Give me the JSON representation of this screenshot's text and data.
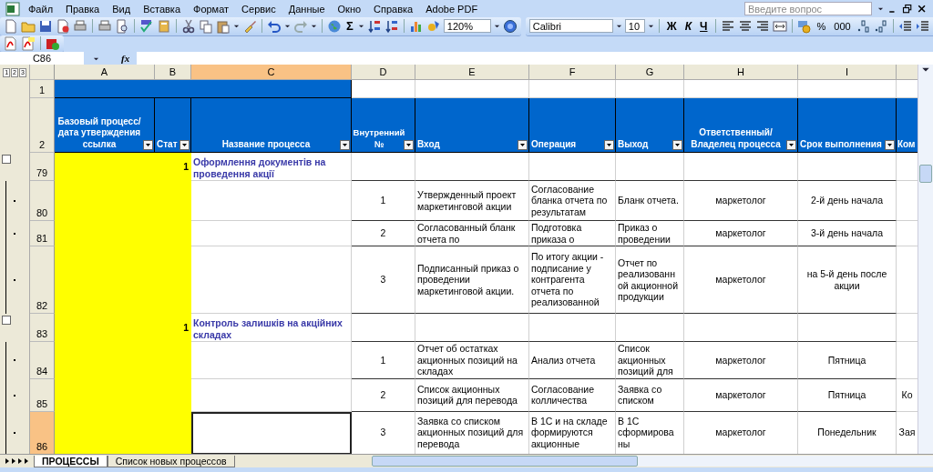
{
  "menu": [
    "Файл",
    "Правка",
    "Вид",
    "Вставка",
    "Формат",
    "Сервис",
    "Данные",
    "Окно",
    "Справка",
    "Adobe PDF"
  ],
  "help_search": {
    "placeholder": "Введите вопрос"
  },
  "toolbar": {
    "autosum": "Σ",
    "zoom": "120%",
    "font": "Calibri",
    "font_size": "10",
    "bold": "Ж",
    "italic": "К",
    "underline": "Ч",
    "percent": "%",
    "thousands": "000"
  },
  "formula_bar": {
    "name_box": "C86",
    "function_label": "fx"
  },
  "outline_levels": [
    "1",
    "2",
    "3"
  ],
  "columns": [
    {
      "letter": "A",
      "selected": false
    },
    {
      "letter": "B",
      "selected": false
    },
    {
      "letter": "C",
      "selected": true
    },
    {
      "letter": "D",
      "selected": false
    },
    {
      "letter": "E",
      "selected": false
    },
    {
      "letter": "F",
      "selected": false
    },
    {
      "letter": "G",
      "selected": false
    },
    {
      "letter": "H",
      "selected": false
    },
    {
      "letter": "I",
      "selected": false
    }
  ],
  "header_rows": [
    "1",
    "2"
  ],
  "headers": [
    {
      "text": "Базовый процесс/ дата утверждения ссылка",
      "filter": true
    },
    {
      "text": "Стат",
      "filter": true
    },
    {
      "text": "Название процесса",
      "filter": true
    },
    {
      "text": "Внутренний №",
      "filter": true
    },
    {
      "text": "Вход",
      "filter": true
    },
    {
      "text": "Операция",
      "filter": true
    },
    {
      "text": "Выход",
      "filter": true
    },
    {
      "text": "Ответственный/Владелец процесса",
      "filter": true
    },
    {
      "text": "Срок выполнения",
      "filter": true
    },
    {
      "text": "Ком",
      "filter": false
    }
  ],
  "rows": [
    {
      "number": "79",
      "kind": "group",
      "selected": false,
      "cells": {
        "B": "1",
        "C": "Оформлення документів на проведення акції"
      }
    },
    {
      "number": "80",
      "kind": "step",
      "selected": false,
      "cells": {
        "D": "1",
        "E": "Утвержденный проект маркетинговой акции",
        "F": "Согласование бланка отчета по результатам",
        "G": "Бланк отчета.",
        "H": "маркетолог",
        "I": "2-й день начала"
      }
    },
    {
      "number": "81",
      "kind": "step",
      "selected": false,
      "cells": {
        "D": "2",
        "E": "Согласованный бланк отчета по",
        "F": "Подготовка приказа о",
        "G": "Приказ о проведении",
        "H": "маркетолог",
        "I": "3-й день начала"
      }
    },
    {
      "number": "82",
      "kind": "step",
      "selected": false,
      "cells": {
        "D": "3",
        "E": "Подписанный приказ о проведении маркетинговой акции.",
        "F": "По итогу акции - подписание у контрагента отчета по реализованной",
        "G": "Отчет по реализованн ой акционной продукции",
        "H": "маркетолог",
        "I": "на 5-й день после акции"
      }
    },
    {
      "number": "83",
      "kind": "group",
      "selected": false,
      "cells": {
        "B": "1",
        "C": "Контроль залишків на акційних складах"
      }
    },
    {
      "number": "84",
      "kind": "step",
      "selected": false,
      "cells": {
        "D": "1",
        "E": "Отчет об остатках акционных позиций на складах",
        "F": "Анализ отчета",
        "G": "Список акционных позиций для",
        "H": "маркетолог",
        "I": "Пятница"
      }
    },
    {
      "number": "85",
      "kind": "step",
      "selected": false,
      "cells": {
        "D": "2",
        "E": "Список акционных позиций для перевода",
        "F": "Согласование колличества",
        "G": "Заявка со списком",
        "H": "маркетолог",
        "I": "Пятница",
        "J": "Ко"
      }
    },
    {
      "number": "86",
      "kind": "step",
      "selected": true,
      "cells": {
        "D": "3",
        "E": "Заявка со списком акционных позиций для перевода",
        "F": "В 1С и на складе формируются акционные",
        "G": "В 1С сформирова ны",
        "H": "маркетолог",
        "I": "Понедельник",
        "J": "Зая"
      }
    }
  ],
  "sheet_tabs": [
    {
      "label": "ПРОЦЕССЫ",
      "selected": true
    },
    {
      "label": "Список новых процессов",
      "selected": false
    }
  ]
}
